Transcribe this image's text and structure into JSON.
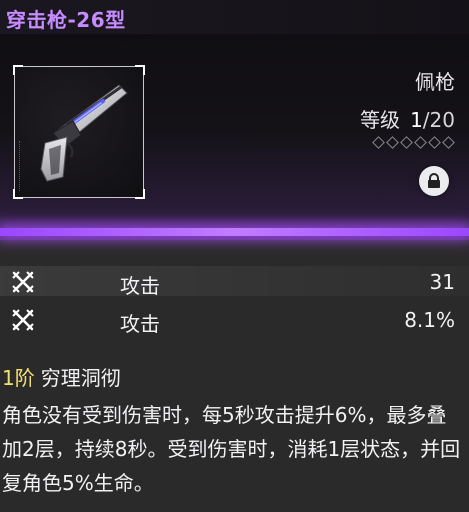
{
  "title": "穿击枪-26型",
  "weapon": {
    "category": "佩枪",
    "level_label": "等级",
    "level_current": "1",
    "level_separator": "/",
    "level_max": "20",
    "star_count": 6,
    "lock_icon": "lock-icon"
  },
  "stats": [
    {
      "icon": "crossed-swords-icon",
      "name": "攻击",
      "value": "31"
    },
    {
      "icon": "crossed-swords-icon",
      "name": "攻击",
      "value": "8.1%"
    }
  ],
  "skill": {
    "tier": "1阶",
    "name": "穷理洞彻",
    "description": "角色没有受到伤害时，每5秒攻击提升6%，最多叠加2层，持续8秒。受到伤害时，消耗1层状态，并回复角色5%生命。"
  },
  "colors": {
    "title": "#c58bff",
    "accent_glow": "#9b47ff",
    "tier": "#f2e070",
    "text": "#f2f1f3"
  }
}
